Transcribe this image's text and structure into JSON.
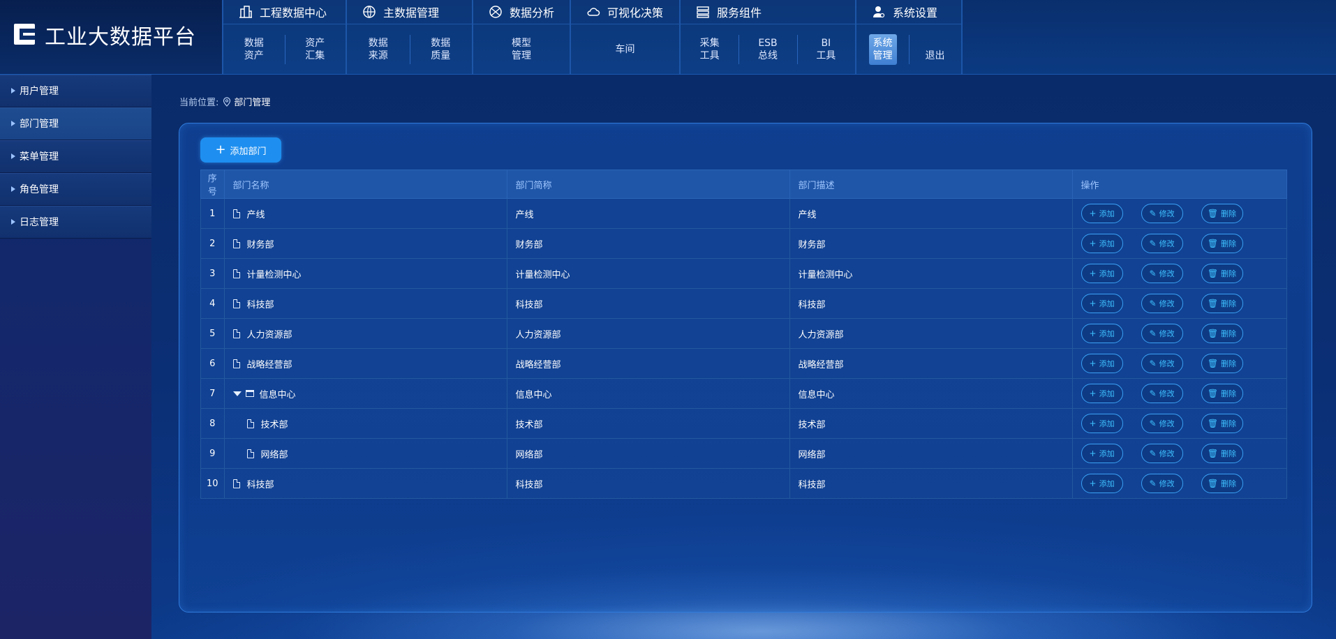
{
  "app": {
    "title": "工业大数据平台"
  },
  "nav": [
    {
      "label": "工程数据中心",
      "icon": "building-icon",
      "items": [
        "数据\n资产",
        "资产\n汇集"
      ]
    },
    {
      "label": "主数据管理",
      "icon": "globe-icon",
      "items": [
        "数据\n来源",
        "数据\n质量"
      ]
    },
    {
      "label": "数据分析",
      "icon": "analysis-icon",
      "items": [
        "模型\n管理"
      ]
    },
    {
      "label": "可视化决策",
      "icon": "cloud-icon",
      "items": [
        "车间"
      ]
    },
    {
      "label": "服务组件",
      "icon": "server-icon",
      "items": [
        "采集\n工具",
        "ESB\n总线",
        "BI\n工具"
      ]
    },
    {
      "label": "系统设置",
      "icon": "user-settings-icon",
      "items": [
        "系统\n管理",
        "退出"
      ]
    }
  ],
  "sidebar": {
    "items": [
      {
        "label": "用户管理"
      },
      {
        "label": "部门管理"
      },
      {
        "label": "菜单管理"
      },
      {
        "label": "角色管理"
      },
      {
        "label": "日志管理"
      }
    ]
  },
  "breadcrumb": {
    "prefix": "当前位置:",
    "current": "部门管理"
  },
  "main": {
    "add_button": "添加部门",
    "columns": [
      "序号",
      "部门名称",
      "部门简称",
      "部门描述",
      "操作"
    ],
    "row_actions": {
      "add": "添加",
      "edit": "修改",
      "delete": "删除"
    },
    "rows": [
      {
        "no": "1",
        "name": "产线",
        "short": "产线",
        "desc": "产线"
      },
      {
        "no": "2",
        "name": "财务部",
        "short": "财务部",
        "desc": "财务部"
      },
      {
        "no": "3",
        "name": "计量检测中心",
        "short": "计量检测中心",
        "desc": "计量检测中心"
      },
      {
        "no": "4",
        "name": "科技部",
        "short": "科技部",
        "desc": "科技部"
      },
      {
        "no": "5",
        "name": "人力资源部",
        "short": "人力资源部",
        "desc": "人力资源部"
      },
      {
        "no": "6",
        "name": "战略经营部",
        "short": "战略经营部",
        "desc": "战略经营部"
      },
      {
        "no": "7",
        "name": "信息中心",
        "short": "信息中心",
        "desc": "信息中心"
      },
      {
        "no": "8",
        "name": "技术部",
        "short": "技术部",
        "desc": "技术部"
      },
      {
        "no": "9",
        "name": "网络部",
        "short": "网络部",
        "desc": "网络部"
      },
      {
        "no": "10",
        "name": "科技部",
        "short": "科技部",
        "desc": "科技部"
      }
    ]
  }
}
